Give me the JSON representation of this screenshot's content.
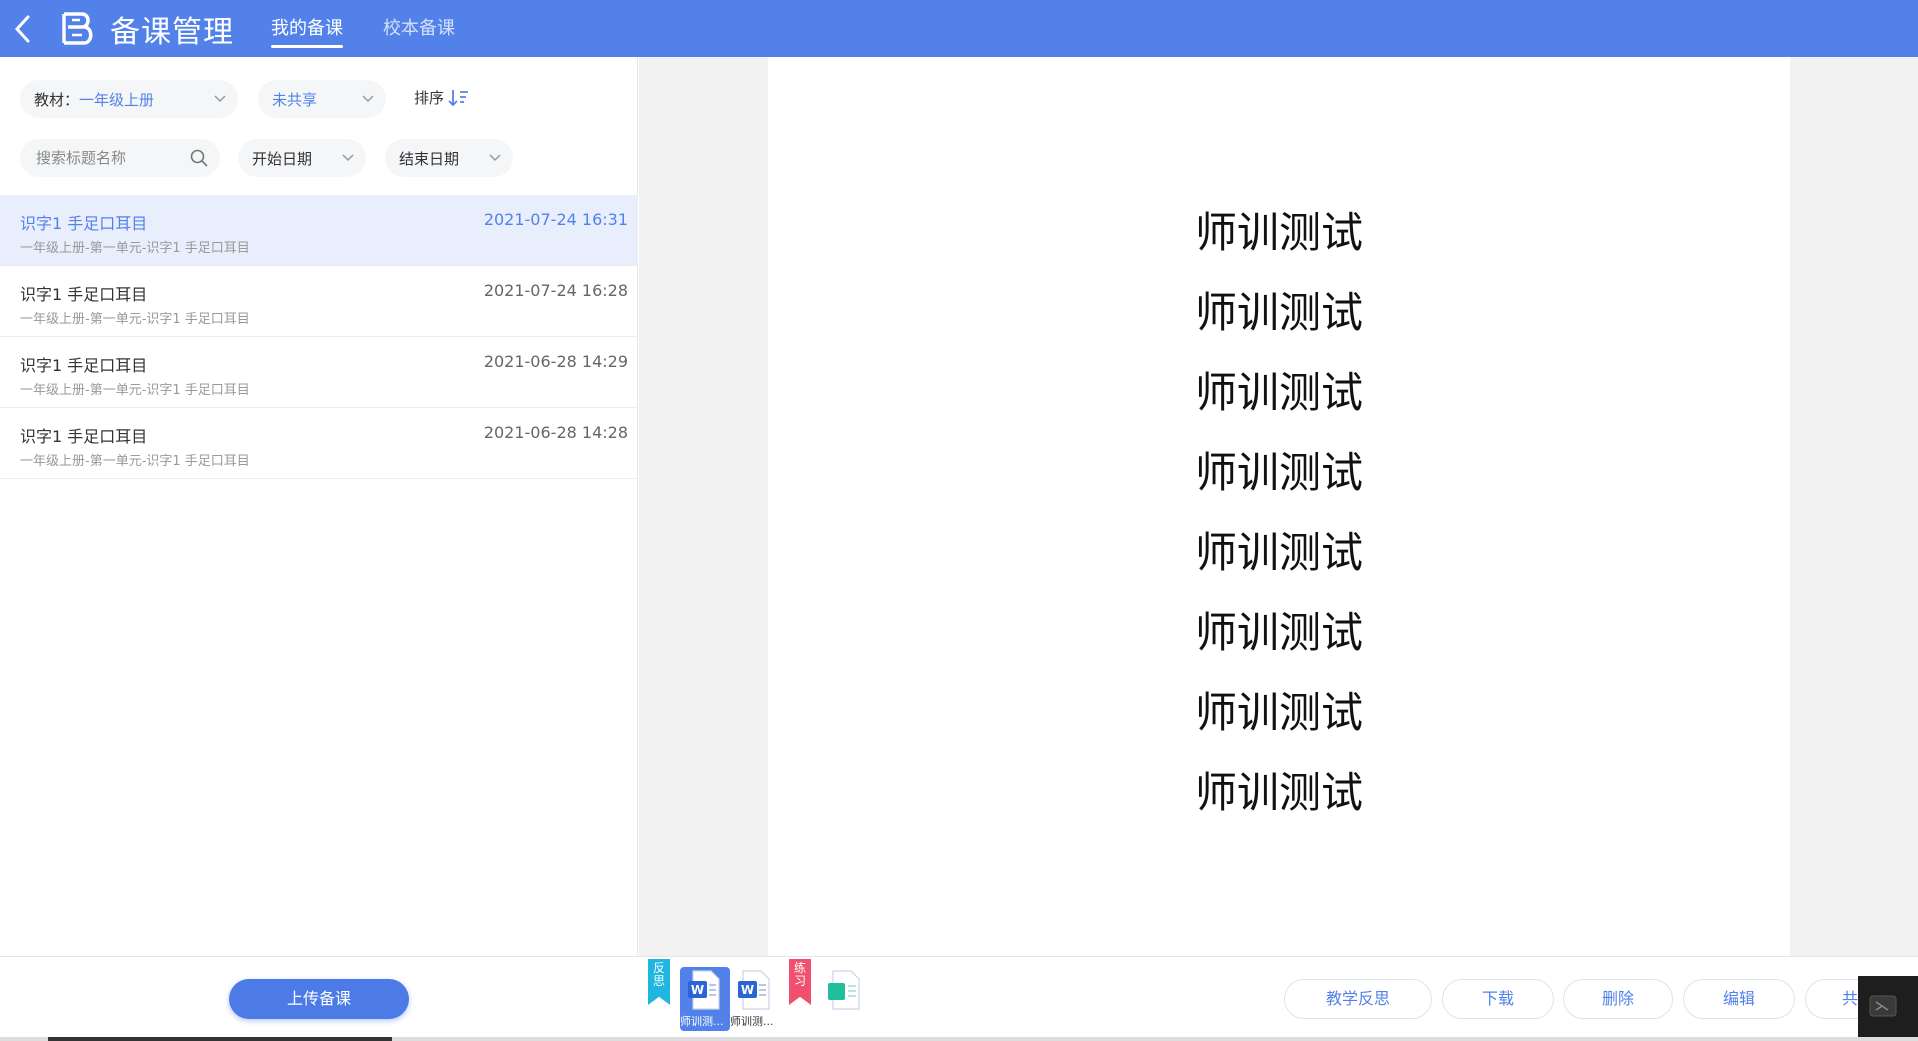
{
  "header": {
    "title": "备课管理",
    "tabs": [
      {
        "label": "我的备课",
        "active": true
      },
      {
        "label": "校本备课",
        "active": false
      }
    ]
  },
  "filters": {
    "textbook_label": "教材：",
    "textbook_value": "一年级上册",
    "share_value": "未共享",
    "sort_label": "排序",
    "search_placeholder": "搜索标题名称",
    "start_date": "开始日期",
    "end_date": "结束日期"
  },
  "lessons": [
    {
      "title": "识字1 手足口耳目",
      "path": "一年级上册-第一单元-识字1 手足口耳目",
      "time": "2021-07-24 16:31",
      "selected": true
    },
    {
      "title": "识字1 手足口耳目",
      "path": "一年级上册-第一单元-识字1 手足口耳目",
      "time": "2021-07-24 16:28",
      "selected": false
    },
    {
      "title": "识字1 手足口耳目",
      "path": "一年级上册-第一单元-识字1 手足口耳目",
      "time": "2021-06-28 14:29",
      "selected": false
    },
    {
      "title": "识字1 手足口耳目",
      "path": "一年级上册-第一单元-识字1 手足口耳目",
      "time": "2021-06-28 14:28",
      "selected": false
    }
  ],
  "document": {
    "lines": [
      "师训测试",
      "师训测试",
      "师训测试",
      "师训测试",
      "师训测试",
      "师训测试",
      "师训测试",
      "师训测试"
    ]
  },
  "bottom": {
    "upload_label": "上传备课",
    "ribbon_reflection": "反思",
    "ribbon_practice": "练习",
    "files": [
      {
        "name": "师训测...",
        "icon": "word-doc-icon",
        "selected": true
      },
      {
        "name": "师训测...",
        "icon": "word-doc-icon",
        "selected": false
      },
      {
        "name": "",
        "icon": "practice-sheet-icon",
        "selected": false
      }
    ],
    "actions": [
      "教学反思",
      "下载",
      "删除",
      "编辑",
      "共"
    ]
  },
  "colors": {
    "brand": "#5282e9",
    "reflection_ribbon": "#1fb6e0",
    "practice_ribbon": "#f0506e",
    "practice_icon": "#1fbf9c"
  }
}
